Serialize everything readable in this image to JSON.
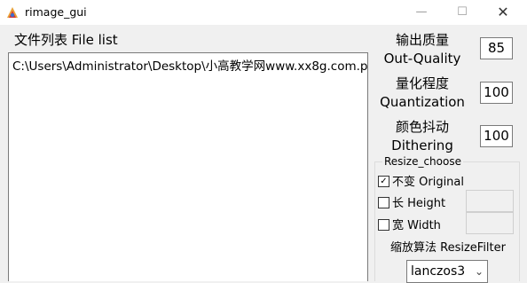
{
  "window": {
    "title": "rimage_gui",
    "min_glyph": "—",
    "max_glyph": "☐",
    "close_glyph": "✕"
  },
  "file_list": {
    "label": "文件列表 File list",
    "items": [
      "C:\\Users\\Administrator\\Desktop\\小高教学网www.xx8g.com.p"
    ]
  },
  "params": {
    "quality": {
      "label_cn": "输出质量",
      "label_en": "Out-Quality",
      "value": "85"
    },
    "quantization": {
      "label_cn": "量化程度",
      "label_en": "Quantization",
      "value": "100"
    },
    "dithering": {
      "label_cn": "颜色抖动",
      "label_en": "Dithering",
      "value": "100"
    }
  },
  "resize": {
    "legend": "Resize_choose",
    "options": [
      {
        "label": "不变 Original",
        "checked": true
      },
      {
        "label": "长 Height",
        "checked": false
      },
      {
        "label": "宽 Width",
        "checked": false
      }
    ],
    "filter_label": "缩放算法 ResizeFilter",
    "filter_value": "lanczos3"
  }
}
